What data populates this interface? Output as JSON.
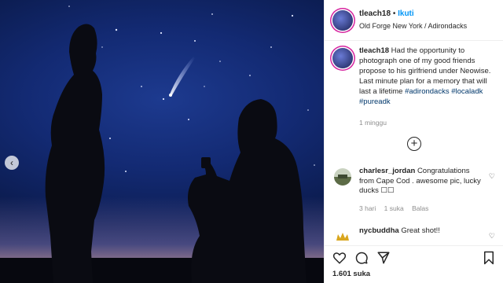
{
  "post": {
    "username": "tleach18",
    "separator": "•",
    "follow_label": "Ikuti",
    "location": "Old Forge New York / Adirondacks"
  },
  "caption": {
    "username": "tleach18",
    "text": "Had the opportunity to photograph one of my good friends propose to his girlfriend under Neowise. Last minute plan for a memory that will last a lifetime",
    "hashtags": [
      "#adirondacks",
      "#localadk",
      "#pureadk"
    ],
    "time": "1 minggu"
  },
  "load_more_label": "+",
  "comments": [
    {
      "username": "charlesr_jordan",
      "text": "Congratulations from Cape Cod . awesome pic, lucky ducks ☐☐",
      "time": "3 hari",
      "likes": "1 suka",
      "reply_label": "Balas"
    },
    {
      "username": "nycbuddha",
      "text": "Great shot!!"
    }
  ],
  "engagement": {
    "likes": "1.601 suka"
  },
  "icons": {
    "like": "heart-icon",
    "comment": "comment-icon",
    "share": "share-icon",
    "save": "bookmark-icon",
    "prev": "chevron-left-icon",
    "comment_like": "heart-outline-icon"
  },
  "colors": {
    "follow": "#0095f6",
    "hashtag": "#00376b",
    "muted": "#8e8e8e"
  }
}
